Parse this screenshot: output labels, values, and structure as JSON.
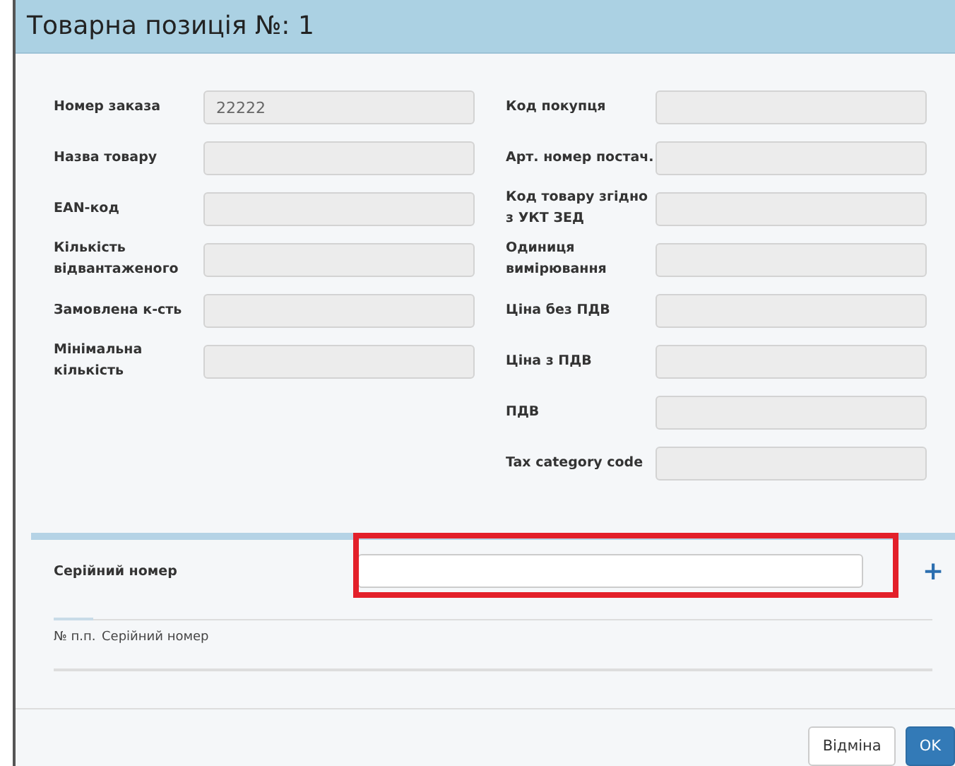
{
  "window": {
    "title": "Товарна позиція №: 1"
  },
  "fields_left": [
    {
      "label": "Номер заказа",
      "value": "22222",
      "disabled": true
    },
    {
      "label": "Назва товару",
      "disabled": true
    },
    {
      "label": "EAN-код",
      "disabled": true
    },
    {
      "label": "Кількість відвантаженого",
      "disabled": true
    },
    {
      "label": "Замовлена к-сть",
      "disabled": true
    },
    {
      "label": "Мінімальна кількість",
      "disabled": true
    }
  ],
  "fields_right": [
    {
      "label": "Код покупця",
      "disabled": true
    },
    {
      "label": "Арт. номер постач.",
      "disabled": true
    },
    {
      "label": "Код товару згідно з УКТ ЗЕД",
      "disabled": true
    },
    {
      "label": "Одиниця вимірювання",
      "disabled": true
    },
    {
      "label": "Ціна без ПДВ",
      "disabled": true
    },
    {
      "label": "Ціна з ПДВ",
      "disabled": true
    },
    {
      "label": "ПДВ",
      "disabled": true
    },
    {
      "label": "Tax category code",
      "disabled": true
    }
  ],
  "serial": {
    "label": "Серійний номер",
    "add": "+",
    "highlighted": true,
    "table": {
      "columns": [
        "№ п.п.",
        "Серійний номер"
      ]
    }
  },
  "buttons": [
    {
      "label": "Відміна",
      "kind": "default"
    },
    {
      "label": "OK",
      "kind": "primary"
    }
  ]
}
